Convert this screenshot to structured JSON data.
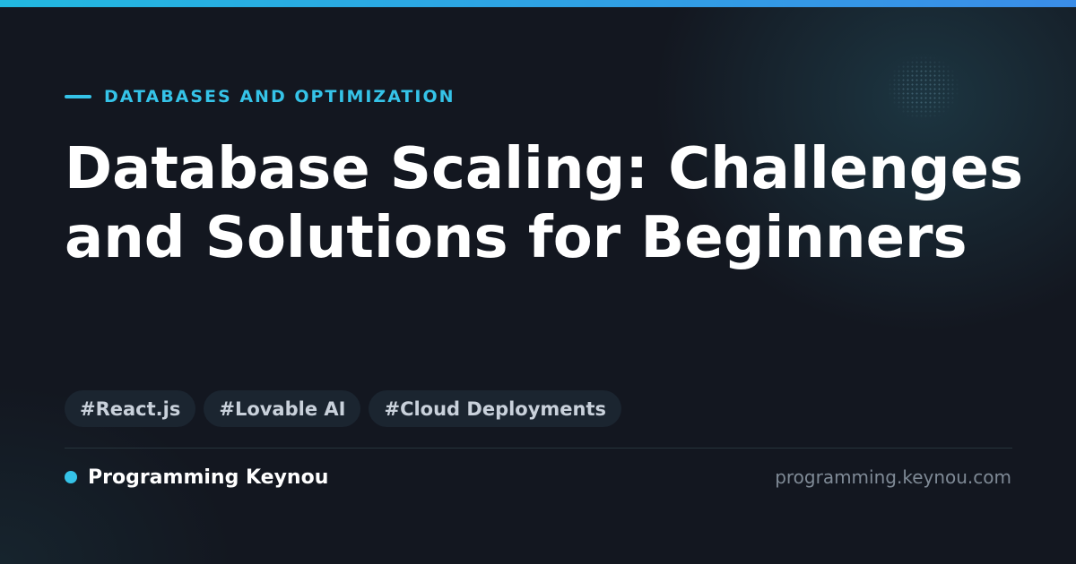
{
  "category": "DATABASES AND OPTIMIZATION",
  "title": "Database Scaling: Challenges and Solutions for Beginners",
  "tags": [
    "#React.js",
    "#Lovable AI",
    "#Cloud Deployments"
  ],
  "brand": "Programming Keynou",
  "site_url": "programming.keynou.com",
  "colors": {
    "accent": "#35c3e8",
    "background": "#131720",
    "title": "#ffffff",
    "tag_bg": "#1b2530",
    "tag_text": "#c9d1db",
    "muted": "#7f8a96"
  }
}
